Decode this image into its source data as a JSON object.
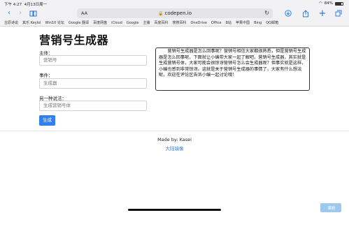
{
  "status": {
    "time": "下午 4:27",
    "date": "4月13日周一",
    "battery_text": "84%",
    "battery_level": 0.84
  },
  "browser": {
    "aa_label": "AA",
    "url": "codepen.io",
    "favorites": [
      "古原诗说",
      "其乐 Keylol",
      "Win10 论坛",
      "Google 翻译",
      "百度网盘",
      "iCloud",
      "Google",
      "主播",
      "百度百科",
      "搜搜百科",
      "OneDrive",
      "Office",
      "B站",
      "苹果中国",
      "Bing",
      "QQ邮箱"
    ]
  },
  "app": {
    "title": "营销号生成器",
    "subject_label": "主体：",
    "subject_placeholder": "营销号",
    "event_label": "事件：",
    "event_placeholder": "生成器",
    "alt_label": "另一种说法：",
    "alt_placeholder": "生成营销号体",
    "generate_button": "生成",
    "output_text": "营销号生成器是怎么回事呢？营销号相信大家都很熟悉，但是营销号生成器是怎么回事呢，下面就让小编带大家一起了解吧。营销号生成器，其实就是生成营销号体，大家可能会很惊讶营销号怎么会生成器呢？但事实就是这样，小编也感到非常惊讶。这就是关于营销号生成器的事情了，大家有什么想法呢，欢迎在评论区告诉小编一起讨论哦！"
  },
  "footer": {
    "made_by": "Made by: Kasei",
    "mirror_link": "大陆镜像"
  },
  "watermark": {
    "text": "果粉"
  }
}
